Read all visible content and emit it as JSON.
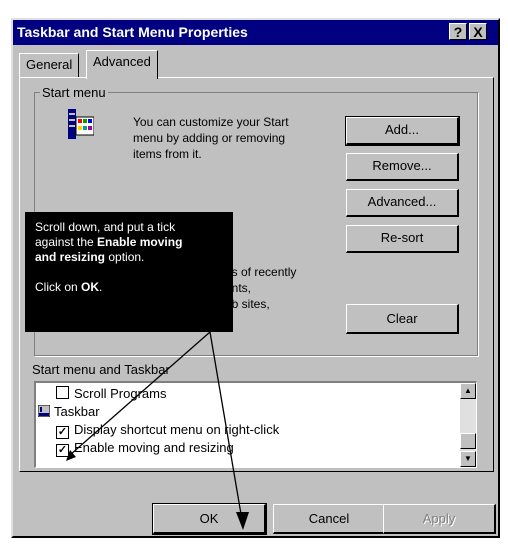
{
  "window": {
    "title": "Taskbar and Start Menu Properties",
    "help_label": "?",
    "close_label": "X"
  },
  "tabs": [
    {
      "label": "General"
    },
    {
      "label": "Advanced"
    }
  ],
  "start_menu": {
    "group_label": "Start menu",
    "description": "You can customize your Start menu by adding or removing items from it.",
    "buttons": {
      "add": "Add...",
      "remove": "Remove...",
      "advanced": "Advanced...",
      "resort": "Re-sort"
    },
    "partial_lines": [
      "ds of recently",
      "ents,",
      "eb sites,"
    ],
    "clear_label": "Clear"
  },
  "taskbar_group": {
    "label": "Start menu and Taskbar",
    "items": [
      {
        "label": "Scroll Programs",
        "checked": false
      },
      {
        "label": "Taskbar"
      },
      {
        "label": "Display shortcut menu on right-click",
        "checked": true
      },
      {
        "label": "Enable moving and resizing",
        "checked": true
      }
    ]
  },
  "footer": {
    "ok": "OK",
    "cancel": "Cancel",
    "apply": "Apply"
  },
  "callout": {
    "line1": "Scroll down, and put a tick",
    "line2_prefix": "against the ",
    "line2_bold": "Enable moving",
    "line3_bold": "and resizing",
    "line3_suffix": " option.",
    "line4_prefix": "Click on ",
    "line4_bold": "OK",
    "line4_suffix": "."
  }
}
